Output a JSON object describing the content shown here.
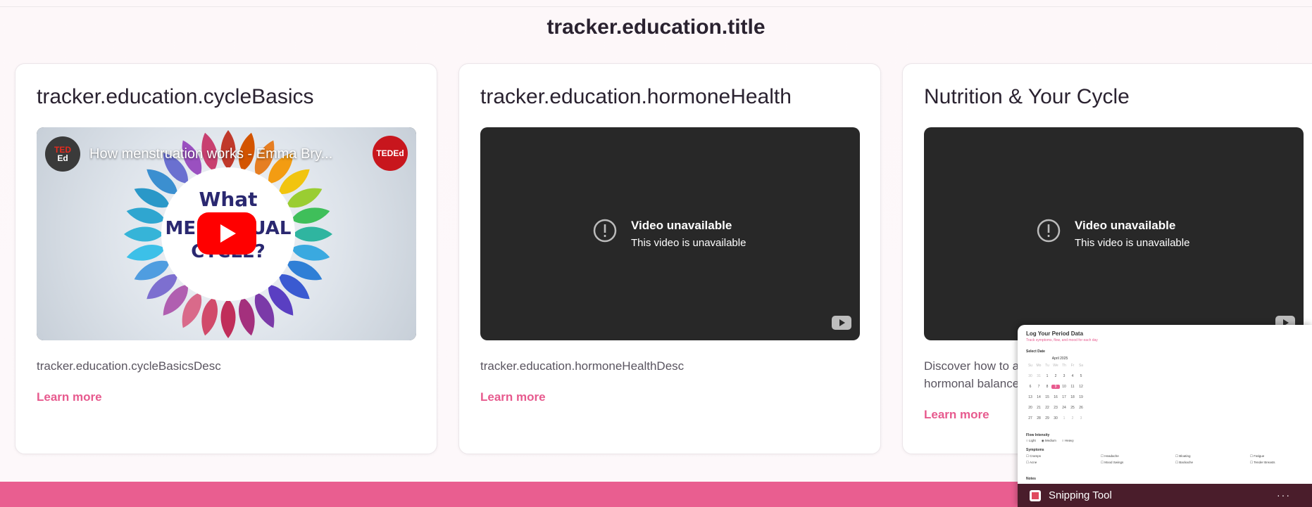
{
  "section": {
    "title": "tracker.education.title"
  },
  "cards": [
    {
      "title": "tracker.education.cycleBasics",
      "desc": "tracker.education.cycleBasicsDesc",
      "link": "Learn more",
      "video": {
        "title": "How menstruation works - Emma Bry...",
        "brand": "TED",
        "brand_sub": "Ed",
        "corner_badge": "TEDEd",
        "poster_text": "What is the MENSTRUAL CYCLE?"
      }
    },
    {
      "title": "tracker.education.hormoneHealth",
      "desc": "tracker.education.hormoneHealthDesc",
      "link": "Learn more",
      "video": {
        "heading": "Video unavailable",
        "message": "This video is unavailable"
      }
    },
    {
      "title": "Nutrition & Your Cycle",
      "desc": "Discover how to a... hormonal balance",
      "desc_line1": "Discover how to a",
      "desc_line2": "hormonal balance",
      "link": "Learn more",
      "video": {
        "heading": "Video unavailable",
        "message": "This video is unavailable"
      }
    }
  ],
  "overlay": {
    "title": "Log Your Period Data",
    "subtitle": "Track symptoms, flow, and mood for each day",
    "select_date": "Select Date",
    "month": "April 2025",
    "weekdays": [
      "Su",
      "Mo",
      "Tu",
      "We",
      "Th",
      "Fr",
      "Sa"
    ],
    "days": [
      "30",
      "31",
      "1",
      "2",
      "3",
      "4",
      "5",
      "6",
      "7",
      "8",
      "9",
      "10",
      "11",
      "12",
      "13",
      "14",
      "15",
      "16",
      "17",
      "18",
      "19",
      "20",
      "21",
      "22",
      "23",
      "24",
      "25",
      "26",
      "27",
      "28",
      "29",
      "30",
      "1",
      "2",
      "3"
    ],
    "selected_day": "9",
    "flow_label": "Flow Intensity",
    "flow_options": [
      "Light",
      "Medium",
      "Heavy"
    ],
    "symptoms_label": "Symptoms",
    "symptoms": [
      "Cramps",
      "Headache",
      "Bloating",
      "Fatigue",
      "Acne",
      "Mood Swings",
      "Backache",
      "Tender Breasts"
    ],
    "notes_label": "Notes",
    "app_name": "Snipping Tool"
  },
  "colors": {
    "accent": "#e75a8e",
    "footer": "#e95e90",
    "video_bg": "#282828"
  }
}
